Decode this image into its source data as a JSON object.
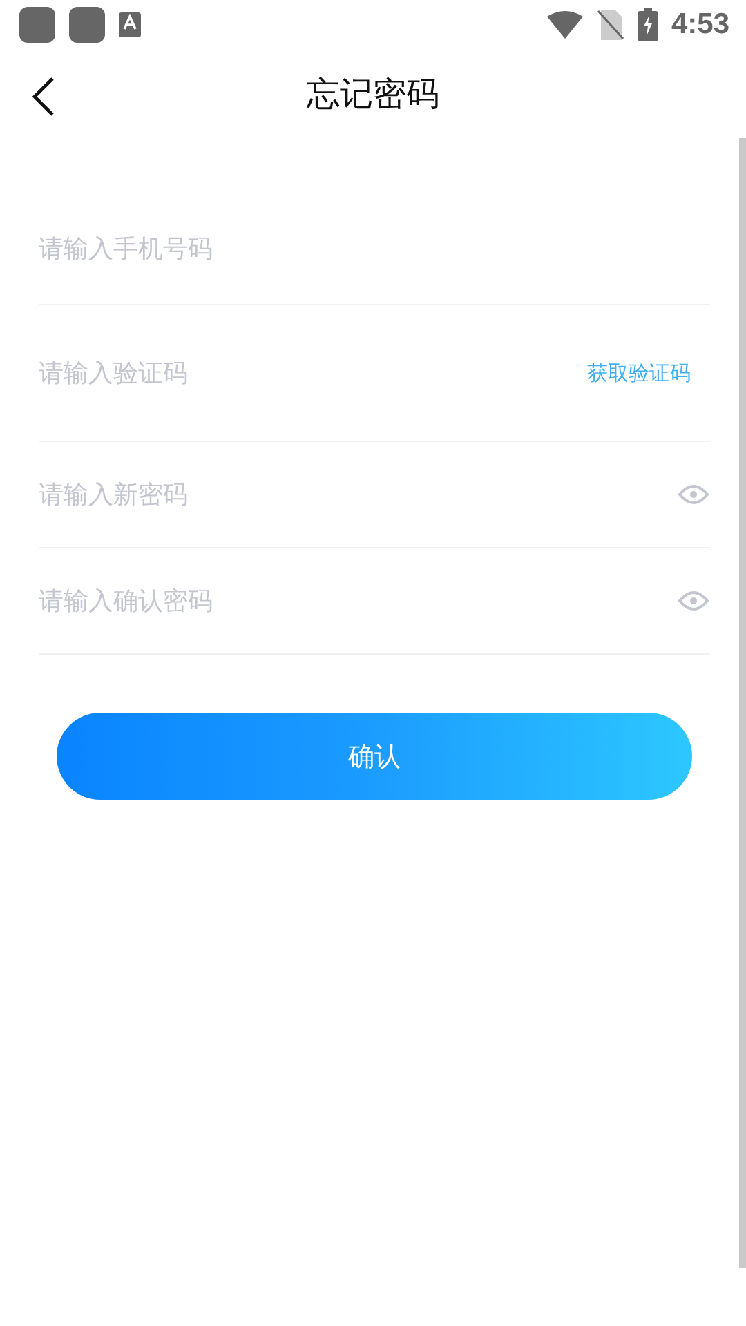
{
  "status_bar": {
    "time": "4:53"
  },
  "header": {
    "title": "忘记密码"
  },
  "fields": [
    {
      "kind": "plain",
      "placeholder": "请输入手机号码"
    },
    {
      "kind": "code",
      "placeholder": "请输入验证码",
      "action": "获取验证码"
    },
    {
      "kind": "password",
      "placeholder": "请输入新密码"
    },
    {
      "kind": "password",
      "placeholder": "请输入确认密码"
    }
  ],
  "submit": "确认"
}
